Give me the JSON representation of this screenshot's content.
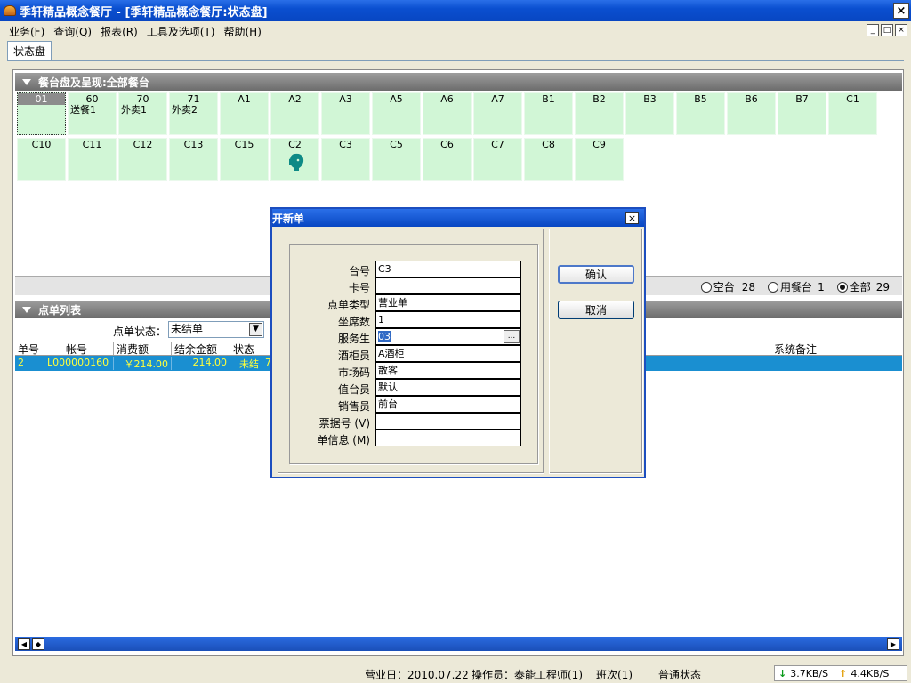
{
  "window": {
    "title": "季轩精品概念餐厅 - [季轩精品概念餐厅:状态盘]",
    "close_icon": "×"
  },
  "menu": [
    "业务(F)",
    "查询(Q)",
    "报表(R)",
    "工具及选项(T)",
    "帮助(H)"
  ],
  "mdi_controls": [
    "_",
    "□",
    "×"
  ],
  "tab": {
    "label": "状态盘"
  },
  "tables_section": {
    "title": "餐台盘及呈现:全部餐台"
  },
  "tables_row1": [
    {
      "no": "01",
      "note": ""
    },
    {
      "no": "60",
      "note": "送餐1"
    },
    {
      "no": "70",
      "note": "外卖1"
    },
    {
      "no": "71",
      "note": "外卖2"
    },
    {
      "no": "A1",
      "note": ""
    },
    {
      "no": "A2",
      "note": ""
    },
    {
      "no": "A3",
      "note": ""
    },
    {
      "no": "A5",
      "note": ""
    },
    {
      "no": "A6",
      "note": ""
    },
    {
      "no": "A7",
      "note": ""
    },
    {
      "no": "B1",
      "note": ""
    },
    {
      "no": "B2",
      "note": ""
    },
    {
      "no": "B3",
      "note": ""
    },
    {
      "no": "B5",
      "note": ""
    },
    {
      "no": "B6",
      "note": ""
    },
    {
      "no": "B7",
      "note": ""
    },
    {
      "no": "C1",
      "note": ""
    }
  ],
  "tables_row2": [
    {
      "no": "C10"
    },
    {
      "no": "C11"
    },
    {
      "no": "C12"
    },
    {
      "no": "C13"
    },
    {
      "no": "C15"
    },
    {
      "no": "C2"
    },
    {
      "no": "C3"
    },
    {
      "no": "C5"
    },
    {
      "no": "C6"
    },
    {
      "no": "C7"
    },
    {
      "no": "C8"
    },
    {
      "no": "C9"
    }
  ],
  "table_filter": {
    "empty_label": "空台",
    "empty_count": "28",
    "used_label": "用餐台",
    "used_count": "1",
    "all_label": "全部",
    "all_count": "29",
    "selected": "全部"
  },
  "orders_section": {
    "title": "点单列表"
  },
  "order_filter": {
    "label": "点单状态：",
    "value": "未结单"
  },
  "order_columns": [
    "单号",
    "帐号",
    "消费额",
    "结余金额",
    "状态",
    "系统备注"
  ],
  "order_rows": [
    {
      "id": "2",
      "account": "L000000160",
      "amount": "￥214.00",
      "balance": "214.00",
      "status": "未结",
      "extra": "7"
    }
  ],
  "statusbar": {
    "business_day": "营业日：2010.07.22",
    "operator": "操作员：泰能工程师(1)",
    "shift": "班次(1)",
    "mode": "普通状态",
    "down_speed": "3.7KB/S",
    "up_speed": "4.4KB/S"
  },
  "dialog": {
    "title": "开新单",
    "close_icon": "×",
    "fields": [
      {
        "label": "台号",
        "value": "C3"
      },
      {
        "label": "卡号",
        "value": ""
      },
      {
        "label": "点单类型",
        "value": "营业单"
      },
      {
        "label": "坐席数",
        "value": "1"
      },
      {
        "label": "服务生",
        "value": "03"
      },
      {
        "label": "酒柜员",
        "value": "A酒柜"
      },
      {
        "label": "市场码",
        "value": "散客"
      },
      {
        "label": "值台员",
        "value": "默认"
      },
      {
        "label": "销售员",
        "value": "前台"
      },
      {
        "label": "票据号 (V)",
        "value": ""
      },
      {
        "label": "单信息 (M)",
        "value": ""
      }
    ],
    "ellipsis": "...",
    "confirm_label": "确认",
    "cancel_label": "取消"
  }
}
